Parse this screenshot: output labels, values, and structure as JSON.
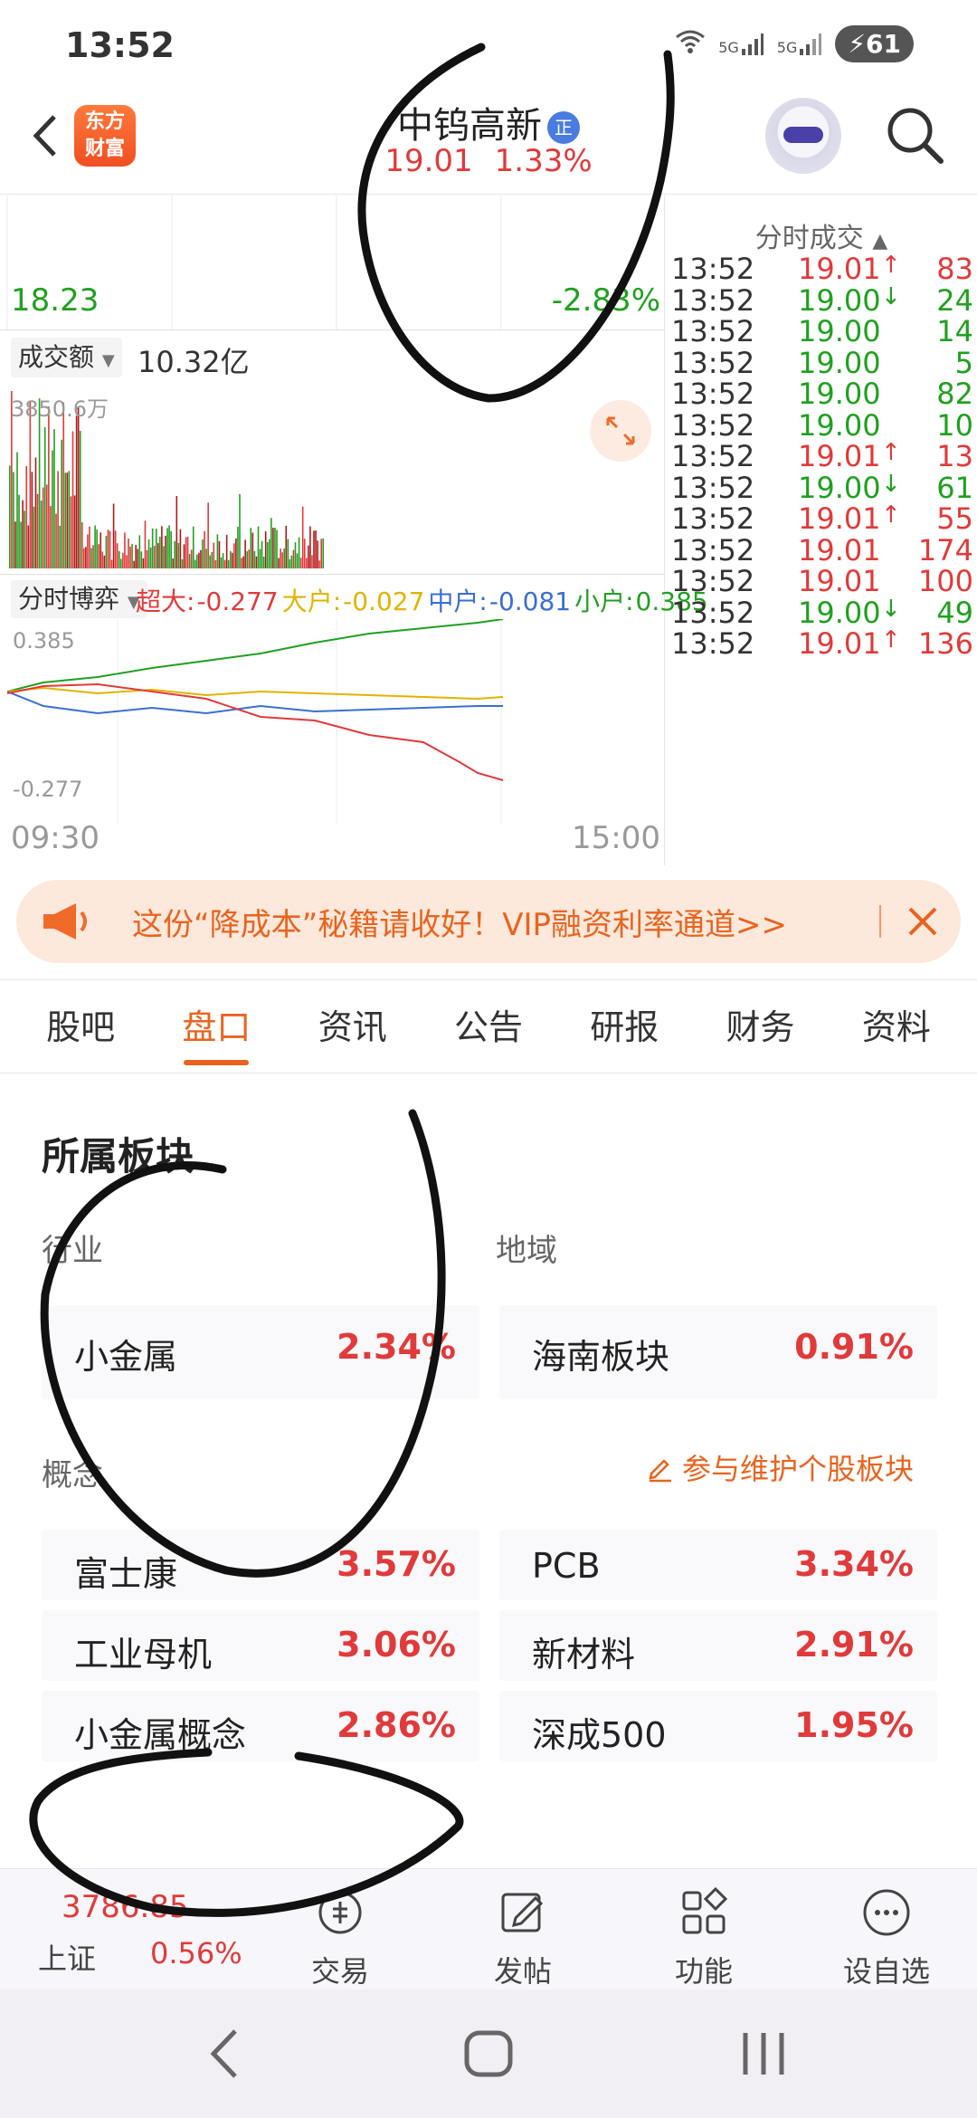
{
  "status_bar": {
    "time": "13:52",
    "net_label_1": "5G",
    "net_label_2": "5G",
    "battery": "61"
  },
  "header": {
    "logo_line1": "东方",
    "logo_line2": "财富",
    "stock_name": "中钨高新",
    "badge": "正",
    "price": "19.01",
    "change_pct": "1.33%"
  },
  "chart": {
    "low_price": "18.23",
    "low_pct": "-2.83%",
    "volume_select": "成交额",
    "volume_value": "10.32亿",
    "volume_max": "3850.6万",
    "flow_select": "分时博弈",
    "flow": [
      {
        "label": "超大:",
        "value": "-0.277",
        "color": "#e03a3a"
      },
      {
        "label": "大户:",
        "value": "-0.027",
        "color": "#e0b400"
      },
      {
        "label": "中户:",
        "value": "-0.081",
        "color": "#3a6fd0"
      },
      {
        "label": "小户:",
        "value": "0.385",
        "color": "#20a020"
      }
    ],
    "flow_top": "0.385",
    "flow_bottom": "-0.277",
    "time_start": "09:30",
    "time_end": "15:00"
  },
  "ticks": {
    "header": "分时成交",
    "rows": [
      {
        "time": "13:52",
        "price": "19.01",
        "dir": "up",
        "vol": "83",
        "vol_color": "red"
      },
      {
        "time": "13:52",
        "price": "19.00",
        "dir": "down",
        "vol": "24",
        "vol_color": "green"
      },
      {
        "time": "13:52",
        "price": "19.00",
        "dir": "",
        "vol": "14",
        "vol_color": "green"
      },
      {
        "time": "13:52",
        "price": "19.00",
        "dir": "",
        "vol": "5",
        "vol_color": "green"
      },
      {
        "time": "13:52",
        "price": "19.00",
        "dir": "",
        "vol": "82",
        "vol_color": "green"
      },
      {
        "time": "13:52",
        "price": "19.00",
        "dir": "",
        "vol": "10",
        "vol_color": "green"
      },
      {
        "time": "13:52",
        "price": "19.01",
        "dir": "up",
        "vol": "13",
        "vol_color": "red"
      },
      {
        "time": "13:52",
        "price": "19.00",
        "dir": "down",
        "vol": "61",
        "vol_color": "green"
      },
      {
        "time": "13:52",
        "price": "19.01",
        "dir": "up",
        "vol": "55",
        "vol_color": "red"
      },
      {
        "time": "13:52",
        "price": "19.01",
        "dir": "",
        "vol": "174",
        "vol_color": "red"
      },
      {
        "time": "13:52",
        "price": "19.01",
        "dir": "",
        "vol": "100",
        "vol_color": "red"
      },
      {
        "time": "13:52",
        "price": "19.00",
        "dir": "down",
        "vol": "49",
        "vol_color": "green"
      },
      {
        "time": "13:52",
        "price": "19.01",
        "dir": "up",
        "vol": "136",
        "vol_color": "red"
      }
    ]
  },
  "banner": {
    "text": "这份“降成本”秘籍请收好！VIP融资利率通道>>"
  },
  "tabs": [
    "股吧",
    "盘口",
    "资讯",
    "公告",
    "研报",
    "财务",
    "资料"
  ],
  "active_tab": "盘口",
  "sectors": {
    "title": "所属板块",
    "industry_label": "行业",
    "region_label": "地域",
    "concept_label": "概念",
    "maintain_link": "参与维护个股板块",
    "industry": {
      "name": "小金属",
      "pct": "2.34%"
    },
    "region": {
      "name": "海南板块",
      "pct": "0.91%"
    },
    "concepts": [
      {
        "name": "富士康",
        "pct": "3.57%"
      },
      {
        "name": "PCB",
        "pct": "3.34%"
      },
      {
        "name": "工业母机",
        "pct": "3.06%"
      },
      {
        "name": "新材料",
        "pct": "2.91%"
      },
      {
        "name": "小金属概念",
        "pct": "2.86%"
      },
      {
        "name": "深成500",
        "pct": "1.95%"
      }
    ]
  },
  "bottom_nav": {
    "index_value": "3786.85",
    "index_name": "上证",
    "index_pct": "0.56%",
    "items": [
      "交易",
      "发帖",
      "功能",
      "设自选"
    ]
  },
  "colors": {
    "accent": "#e8641e",
    "up": "#e03a3a",
    "down": "#20a020"
  }
}
